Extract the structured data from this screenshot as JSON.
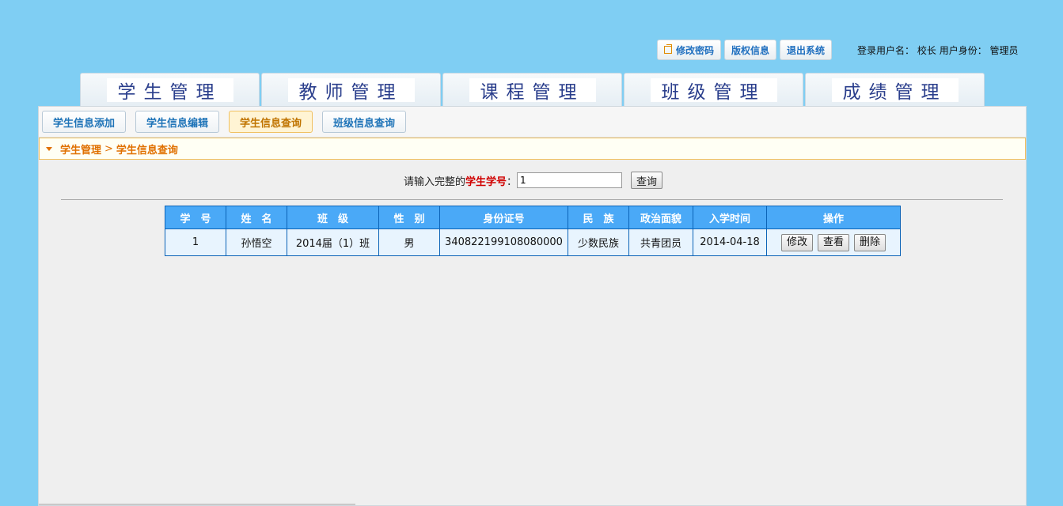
{
  "topbar": {
    "change_password": "修改密码",
    "copyright": "版权信息",
    "logout": "退出系统",
    "login_user_label": "登录用户名：",
    "login_user": "校长",
    "role_label": "用户身份：",
    "role": "管理员"
  },
  "main_nav": [
    {
      "label": "学生管理"
    },
    {
      "label": "教师管理"
    },
    {
      "label": "课程管理"
    },
    {
      "label": "班级管理"
    },
    {
      "label": "成绩管理"
    }
  ],
  "sub_nav": [
    {
      "label": "学生信息添加"
    },
    {
      "label": "学生信息编辑"
    },
    {
      "label": "学生信息查询",
      "active": true
    },
    {
      "label": "班级信息查询"
    }
  ],
  "breadcrumb": {
    "root": "学生管理",
    "separator": ">",
    "current": "学生信息查询"
  },
  "search": {
    "prompt": "请输入完整的",
    "highlight": "学生学号",
    "colon": "：",
    "value": "1",
    "button": "查询"
  },
  "table": {
    "headers": [
      "学　号",
      "姓　名",
      "班　级",
      "性　别",
      "身份证号",
      "民　族",
      "政治面貌",
      "入学时间",
      "操作"
    ],
    "rows": [
      {
        "id": "1",
        "name": "孙悟空",
        "class": "2014届（1）班",
        "gender": "男",
        "id_card": "340822199108080000",
        "ethnicity": "少数民族",
        "political": "共青团员",
        "enroll_date": "2014-04-18",
        "actions": [
          "修改",
          "查看",
          "删除"
        ]
      }
    ]
  }
}
